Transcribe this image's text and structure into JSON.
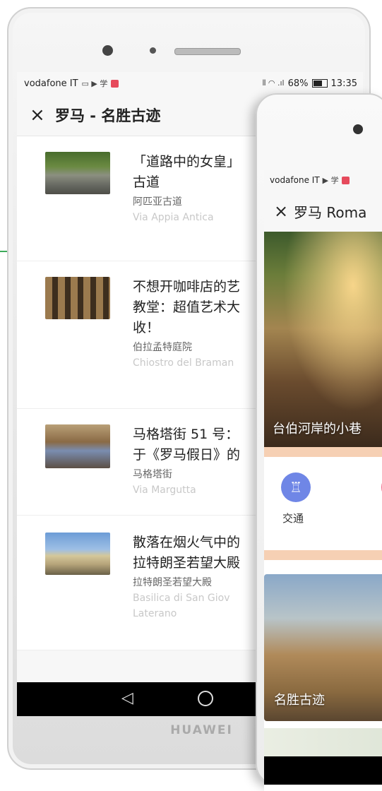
{
  "phone_left": {
    "status_bar": {
      "carrier": "vodafone IT",
      "left_glyphs": "▭ ▶ 学",
      "right_glyphs": "⫴ ◠ .ıl",
      "battery": "68%",
      "time": "13:35"
    },
    "header": {
      "close_symbol": "×",
      "title": "罗马 - 名胜古迹"
    },
    "items": [
      {
        "title": "「道路中的女皇」",
        "title_line2": "古道",
        "name_cn": "阿匹亚古道",
        "name_it": "Via Appia Antica"
      },
      {
        "title": "不想开咖啡店的艺",
        "title_line2": "教堂：超值艺术大",
        "title_line3": "收！",
        "name_cn": "伯拉孟特庭院",
        "name_it": "Chiostro del Braman"
      },
      {
        "title": "马格塔街 51 号：",
        "title_line2": "于《罗马假日》的",
        "name_cn": "马格塔街",
        "name_it": "Via Margutta"
      },
      {
        "title": "散落在烟火气中的",
        "title_line2": "拉特朗圣若望大殿",
        "name_cn": "拉特朗圣若望大殿",
        "name_it": "Basilica di San Giov",
        "name_it_line2": "Laterano"
      }
    ],
    "nav_bar": {
      "back_symbol": "◁"
    },
    "brand": "HUAWEI"
  },
  "phone_right": {
    "status_bar": {
      "carrier": "vodafone IT",
      "glyphs": "▶ 学"
    },
    "header": {
      "close_symbol": "×",
      "title": "罗马 Roma"
    },
    "hero_caption": "台伯河岸的小巷",
    "quick_action": {
      "label": "交通",
      "icon_glyph": "♖"
    },
    "card_caption": "名胜古迹"
  },
  "colors": {
    "accent_line": "#3daa5a",
    "transit_icon_bg": "#6f86e6",
    "peach_bar": "#f6d0b4",
    "status_red_icon": "#e64a5c"
  },
  "icons": [
    "close-icon",
    "back-icon",
    "home-icon",
    "train-icon",
    "battery-icon"
  ]
}
